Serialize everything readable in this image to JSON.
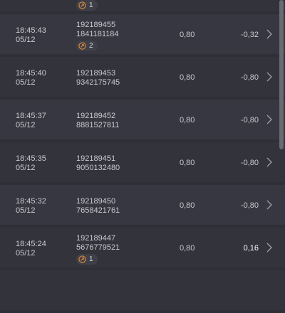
{
  "rows": [
    {
      "time": "",
      "date": "",
      "id1": "",
      "id2": "",
      "odd": "",
      "profit": "",
      "badge": "1",
      "hasId2": false
    },
    {
      "time": "18:45:43",
      "date": "05/12",
      "id1": "192189455",
      "id2": "1841181184",
      "odd": "0,80",
      "profit": "-0,32",
      "badge": "2"
    },
    {
      "time": "18:45:40",
      "date": "05/12",
      "id1": "192189453",
      "id2": "9342175745",
      "odd": "0,80",
      "profit": "-0,80",
      "badge": null
    },
    {
      "time": "18:45:37",
      "date": "05/12",
      "id1": "192189452",
      "id2": "8881527811",
      "odd": "0,80",
      "profit": "-0,80",
      "badge": null
    },
    {
      "time": "18:45:35",
      "date": "05/12",
      "id1": "192189451",
      "id2": "9050132480",
      "odd": "0,80",
      "profit": "-0,80",
      "badge": null
    },
    {
      "time": "18:45:32",
      "date": "05/12",
      "id1": "192189450",
      "id2": "7658421761",
      "odd": "0,80",
      "profit": "-0,80",
      "badge": null
    },
    {
      "time": "18:45:24",
      "date": "05/12",
      "id1": "192189447",
      "id2": "5676779521",
      "odd": "0,80",
      "profit": "0,16",
      "badge": "1"
    }
  ],
  "icons": {
    "badge": "split-arrows-icon",
    "chevron": "chevron-right-icon"
  },
  "colors": {
    "background": "#2f2f38",
    "row": "#373741",
    "badge_ring": "#d98a3a",
    "positive": "#ffffff"
  }
}
